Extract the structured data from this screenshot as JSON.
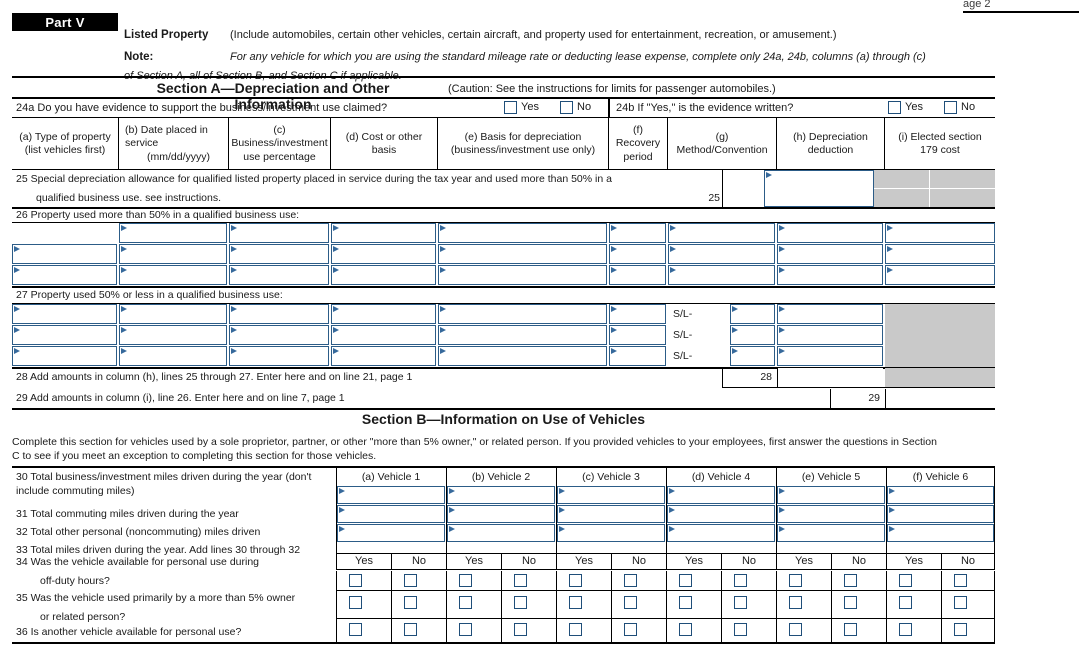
{
  "page": {
    "page_label": "age 2"
  },
  "part": {
    "badge": "Part V",
    "title": "Listed Property",
    "title_desc": "(Include automobiles, certain other vehicles, certain aircraft, and property used for entertainment, recreation, or amusement.)",
    "note_label": "Note:",
    "note_line1": "For any vehicle for which you are using the standard mileage rate or deducting lease expense, complete only 24a, 24b, columns (a) through (c)",
    "note_line2": "of Section A, all of Section B, and Section C if applicable."
  },
  "section_a": {
    "title": "Section A—Depreciation and Other Information",
    "caution": "(Caution: See the instructions for limits for passenger automobiles.)",
    "q24a": {
      "text": "24a Do you have evidence to support the business/investment use claimed?",
      "yes": "Yes",
      "no": "No"
    },
    "q24b": {
      "text": "24b If \"Yes,\" is the evidence written?",
      "yes": "Yes",
      "no": "No"
    },
    "columns": [
      {
        "id": "a",
        "line1": "(a)  Type of property",
        "line2": "(list vehicles first)",
        "line3": ""
      },
      {
        "id": "b",
        "line1": "(b)  Date placed in",
        "line2": "service",
        "line3": "(mm/dd/yyyy)"
      },
      {
        "id": "c",
        "line1": "(c)",
        "line2": "Business/investment",
        "line3": "use percentage"
      },
      {
        "id": "d",
        "line1": "(d)  Cost or other",
        "line2": "basis",
        "line3": ""
      },
      {
        "id": "e",
        "line1": "(e)  Basis for depreciation",
        "line2": "(business/investment use only)",
        "line3": ""
      },
      {
        "id": "f",
        "line1": "(f)",
        "line2": "Recovery",
        "line3": "period"
      },
      {
        "id": "g",
        "line1": "(g)",
        "line2": "Method/Convention",
        "line3": ""
      },
      {
        "id": "h",
        "line1": "(h)  Depreciation",
        "line2": "deduction",
        "line3": ""
      },
      {
        "id": "i",
        "line1": "(i)  Elected section",
        "line2": "179 cost",
        "line3": ""
      }
    ],
    "line25": {
      "text1": "25 Special depreciation allowance for qualified listed property placed in service during the tax year and used more than 50% in a",
      "text2": "qualified business use. see instructions.",
      "number": "25"
    },
    "line26": {
      "text": "26 Property used more than 50% in a qualified business use:"
    },
    "line27": {
      "text": "27 Property used 50% or less in a qualified business use:",
      "sl_label": "S/L-"
    },
    "line28": {
      "text": "28 Add amounts in column (h), lines 25 through 27.  Enter here and on line 21, page 1",
      "number": "28"
    },
    "line29": {
      "text": "29 Add amounts in column (i), line 26.  Enter here and on line 7, page 1",
      "number": "29"
    }
  },
  "section_b": {
    "title": "Section B—Information on Use of Vehicles",
    "intro_line1": "Complete this section for vehicles used by a sole proprietor, partner, or other \"more than 5% owner,\" or related person.  If you provided vehicles to your employees, first answer the questions in Section",
    "intro_line2": "C to see if you meet an exception to completing this section for those vehicles.",
    "vehicle_headers": [
      "(a)  Vehicle 1",
      "(b)  Vehicle 2",
      "(c)  Vehicle 3",
      "(d)  Vehicle 4",
      "(e)  Vehicle 5",
      "(f)  Vehicle 6"
    ],
    "lines": [
      {
        "num": "30",
        "line1": "30 Total business/investment miles driven during the year (don't",
        "line2": "include commuting miles)"
      },
      {
        "num": "31",
        "line1": "31 Total commuting miles driven during the year",
        "line2": ""
      },
      {
        "num": "32",
        "line1": "32 Total other personal (noncommuting) miles driven",
        "line2": ""
      },
      {
        "num": "33",
        "line1": "33 Total miles driven during the year.  Add lines 30 through 32",
        "line2": ""
      }
    ],
    "yes_label": "Yes",
    "no_label": "No",
    "questions": [
      {
        "num": "34",
        "line1": "34 Was the vehicle available for personal use during",
        "line2": "off-duty hours?"
      },
      {
        "num": "35",
        "line1": "35 Was the vehicle used primarily by a more than 5% owner",
        "line2": "or related person?"
      },
      {
        "num": "36",
        "line1": "36 Is another vehicle available for personal use?",
        "line2": ""
      }
    ]
  },
  "colors": {
    "entry_border": "#2c5c87",
    "flag": "#36699b",
    "checkbox_border": "#1f4e79",
    "shade": "#c9c9c9",
    "rule": "#000000"
  }
}
